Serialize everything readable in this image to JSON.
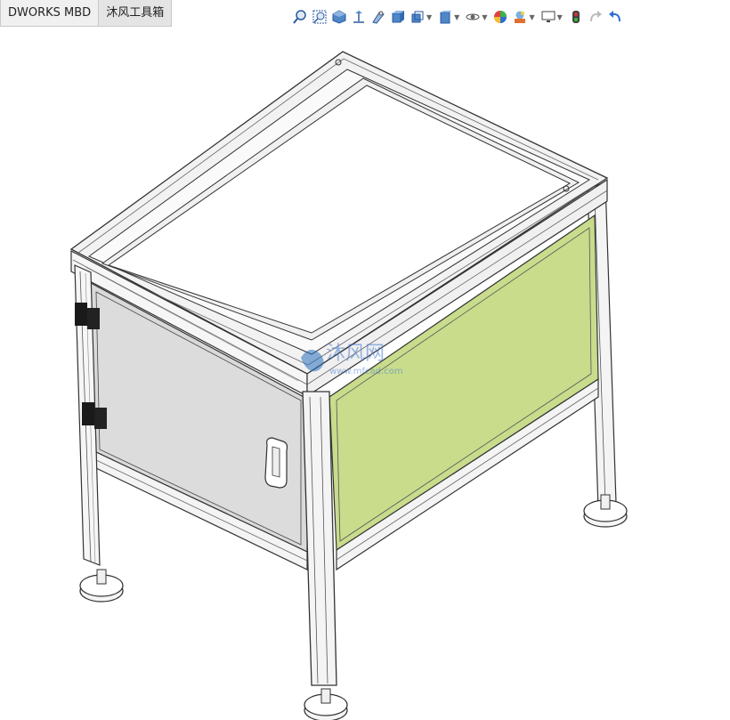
{
  "tabs": [
    {
      "label": "DWORKS MBD",
      "active": false
    },
    {
      "label": "沐风工具箱",
      "active": true
    }
  ],
  "toolbar": {
    "icons": [
      "zoom-to-fit-icon",
      "zoom-area-icon",
      "previous-view-icon",
      "section-view-icon",
      "dynamic-annotation-icon",
      "view-orientation-icon",
      "display-style-icon",
      "hide-show-items-icon",
      "edit-appearance-icon",
      "apply-scene-icon",
      "view-settings-icon",
      "traffic-light-icon",
      "redo-icon",
      "undo-icon"
    ]
  },
  "watermark": {
    "brand": "沐风网",
    "url": "www.mfcad.com"
  },
  "colors": {
    "door_panel": "#d9d9d9",
    "side_panel": "#c8dc8c",
    "frame": "#f2f2f2",
    "outline": "#333333"
  }
}
